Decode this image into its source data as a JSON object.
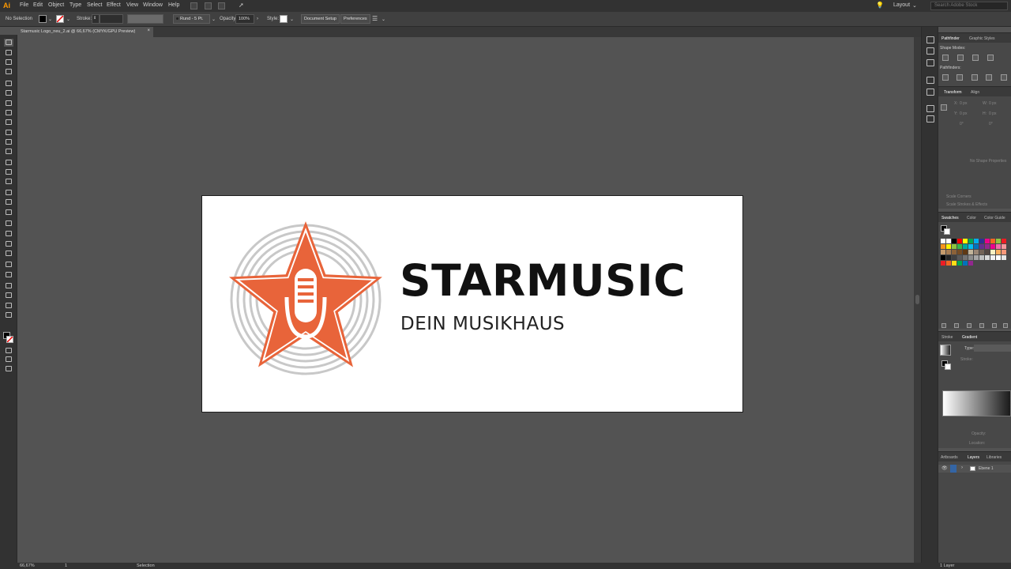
{
  "app": {
    "logo": "Ai"
  },
  "menu": [
    "File",
    "Edit",
    "Object",
    "Type",
    "Select",
    "Effect",
    "View",
    "Window",
    "Help"
  ],
  "topright": {
    "workspace": "Layout",
    "search_placeholder": "Search Adobe Stock"
  },
  "control": {
    "selection": "No Selection",
    "stroke_label": "Stroke:",
    "brush": "Rund - 5 Pt.",
    "opacity_label": "Opacity:",
    "opacity_value": "100%",
    "style_label": "Style:",
    "document_setup": "Document Setup",
    "preferences": "Preferences"
  },
  "document": {
    "tab_title": "Starmusic Logo_neu_2.ai @ 66,67% (CMYK/GPU Preview)"
  },
  "artwork": {
    "title": "STARMUSIC",
    "subtitle": "DEIN MUSIKHAUS",
    "accent": "#e8643a",
    "ring_color": "#c8c8c8"
  },
  "panels": {
    "pathfinder": {
      "tabs": [
        "Pathfinder",
        "Graphic Styles"
      ],
      "shape_modes": "Shape Modes:",
      "pathfinders": "Pathfinders:"
    },
    "transform": {
      "tabs": [
        "Transform",
        "Align"
      ],
      "x_label": "X:",
      "y_label": "Y:",
      "w_label": "W:",
      "h_label": "H:",
      "x": "0 px",
      "y": "0 px",
      "w": "0 px",
      "h": "0 px",
      "angle": "0°",
      "no_shape": "No Shape Properties",
      "scale_corners": "Scale Corners",
      "scale_strokes": "Scale Strokes & Effects"
    },
    "swatches": {
      "tabs": [
        "Swatches",
        "Color",
        "Color Guide"
      ]
    },
    "gradient": {
      "tabs": [
        "Stroke",
        "Gradient"
      ],
      "type_label": "Type:",
      "stroke_label": "Stroke:",
      "opacity_label": "Opacity:",
      "location_label": "Location:"
    },
    "layers": {
      "tabs": [
        "Artboards",
        "Layers",
        "Libraries"
      ],
      "layer_name": "Ebene 1",
      "count": "1 Layer"
    }
  },
  "status": {
    "zoom": "66,67%",
    "artboard": "1",
    "tool": "Selection"
  }
}
